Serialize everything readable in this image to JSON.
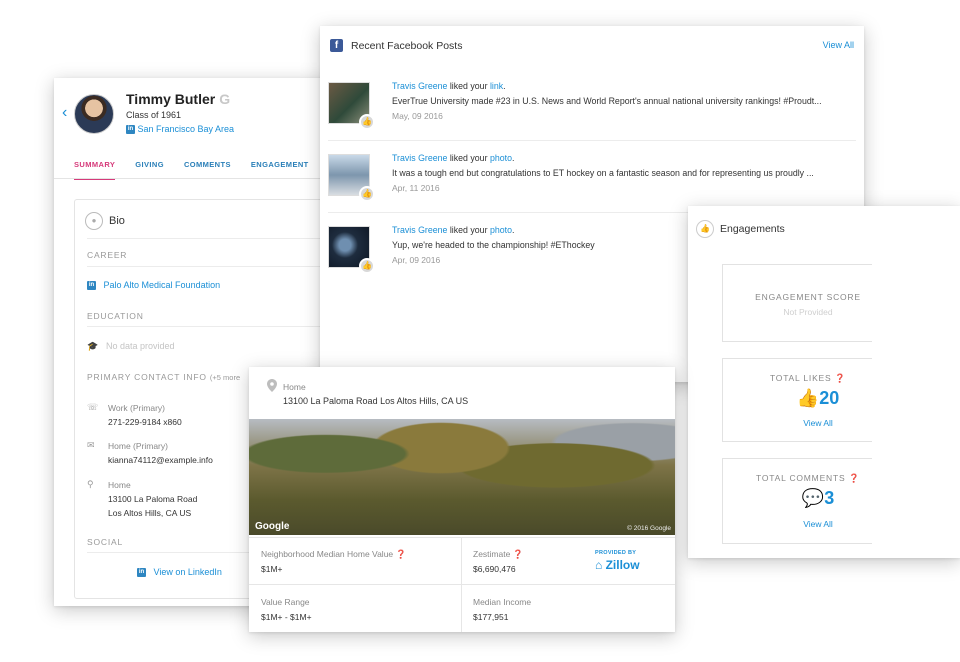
{
  "profile": {
    "name": "Timmy Butler",
    "badge": "G",
    "class_year": "Class of 1961",
    "location": "San Francisco Bay Area",
    "tabs": [
      "SUMMARY",
      "GIVING",
      "COMMENTS",
      "ENGAGEMENT"
    ],
    "bio_title": "Bio",
    "career_header": "CAREER",
    "career_employer": "Palo Alto Medical Foundation",
    "education_header": "EDUCATION",
    "education_value": "No data provided",
    "contact_header": "PRIMARY CONTACT INFO",
    "contact_more": "(+5 more",
    "work_label": "Work (Primary)",
    "work_phone": "271-229-9184 x860",
    "email_label": "Home (Primary)",
    "email": "kianna74112@example.info",
    "home_label": "Home",
    "home_line1": "13100 La Paloma Road",
    "home_line2": "Los Altos Hills, CA US",
    "social_header": "SOCIAL",
    "linkedin_link": "View on LinkedIn"
  },
  "facebook": {
    "title": "Recent Facebook Posts",
    "view_all": "View All",
    "posts": [
      {
        "user": "Travis Greene",
        "action": " liked your ",
        "object": "link",
        "text": "EverTrue University made #23 in U.S. News and World Report's annual national university rankings! #Proudt...",
        "date": "May, 09 2016"
      },
      {
        "user": "Travis Greene",
        "action": " liked your ",
        "object": "photo",
        "text": "It was a tough end but congratulations to ET hockey on a fantastic season and for representing us proudly ...",
        "date": "Apr, 11 2016"
      },
      {
        "user": "Travis Greene",
        "action": " liked your ",
        "object": "photo",
        "text": "Yup, we're headed to the championship! #EThockey",
        "date": "Apr, 09 2016"
      }
    ]
  },
  "engagements": {
    "title": "Engagements",
    "score_label": "ENGAGEMENT SCORE",
    "score_value": "Not Provided",
    "likes_label": "TOTAL LIKES",
    "likes_value": "20",
    "likes_link": "View All",
    "comments_label": "TOTAL COMMENTS",
    "comments_value": "3",
    "comments_link": "View All"
  },
  "home": {
    "label": "Home",
    "address": "13100 La Paloma Road Los Altos Hills, CA US",
    "photo_brand": "Google",
    "photo_copyright": "© 2016 Google",
    "median_value_label": "Neighborhood Median Home Value",
    "median_value": "$1M+",
    "zestimate_label": "Zestimate",
    "zestimate": "$6,690,476",
    "provided_by": "PROVIDED BY",
    "zillow": "Zillow",
    "range_label": "Value Range",
    "range": "$1M+ - $1M+",
    "income_label": "Median Income",
    "income": "$177,951"
  }
}
